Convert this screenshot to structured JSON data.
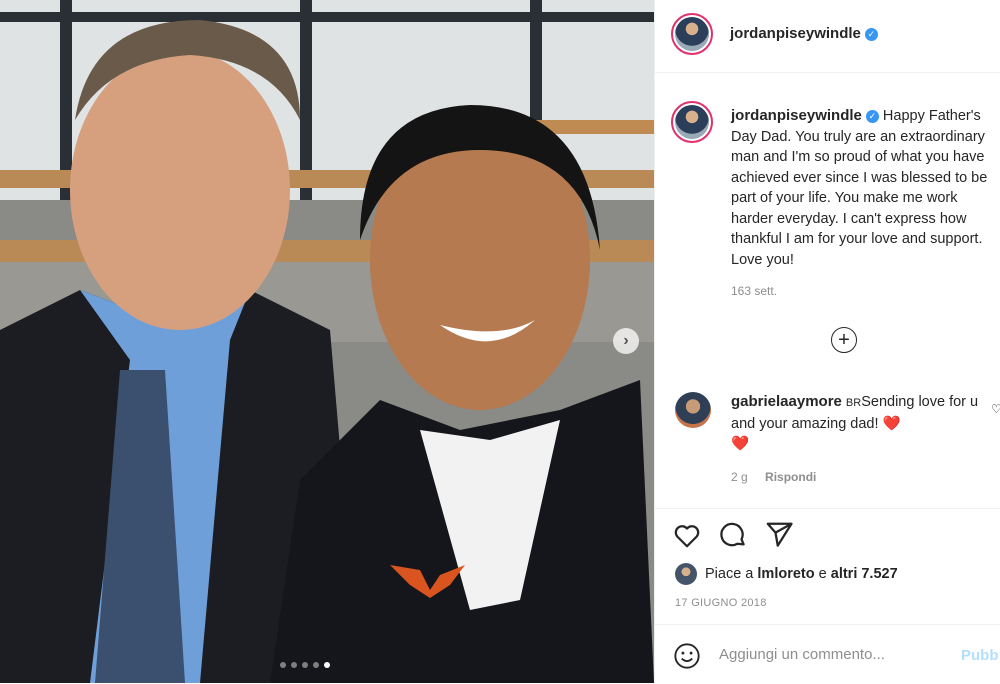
{
  "post": {
    "username": "jordanpiseywindle",
    "caption": "Happy Father's Day Dad. You truly are an extraordinary man and I'm so proud of what you have achieved ever since I was blessed to be part of your life. You make me work harder everyday. I can't express how thankful I am for your love and support. Love you!",
    "caption_time": "163 sett.",
    "carousel": {
      "dot_count": 5,
      "active_index": 4
    }
  },
  "comment": {
    "username": "gabrielaaymore",
    "tag": "BR",
    "text_before_emoji": "Sending love for u and your amazing dad!",
    "emoji": "❤️",
    "emoji2": "❤️",
    "time": "2 g",
    "reply_label": "Rispondi"
  },
  "likes": {
    "prefix": "Piace a",
    "user": "lmloreto",
    "conj": "e",
    "others": "altri 7.527"
  },
  "date": "17 GIUGNO 2018",
  "comment_bar": {
    "placeholder": "Aggiungi un commento...",
    "publish_label": "Pubb"
  },
  "icons": [
    "chevron-right-icon",
    "plus-circle-icon",
    "heart-icon",
    "comment-icon",
    "share-icon",
    "emoji-icon",
    "verified-icon"
  ],
  "colors": {
    "accent": "#3897f0",
    "publish_disabled": "#b2dffc",
    "heart_red": "#ed4956"
  }
}
